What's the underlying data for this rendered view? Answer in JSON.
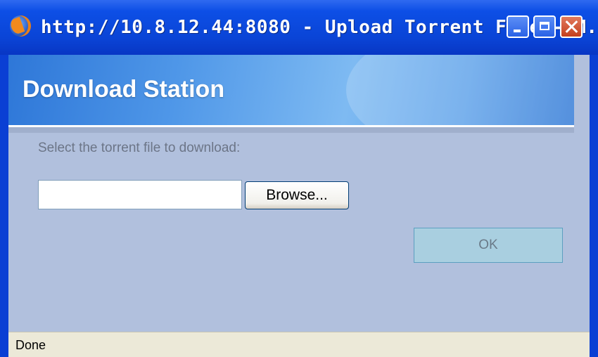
{
  "window": {
    "title": "http://10.8.12.44:8080 - Upload Torrent File - M...",
    "controls": {
      "minimize": "minimize-icon",
      "maximize": "maximize-icon",
      "close": "close-icon"
    }
  },
  "banner": {
    "title": "Download Station"
  },
  "form": {
    "prompt": "Select the torrent file to download:",
    "file_value": "",
    "browse_label": "Browse...",
    "ok_label": "OK"
  },
  "status": {
    "text": "Done"
  },
  "colors": {
    "titlebar": "#0a44d6",
    "client_bg": "#b1c0dd",
    "banner": "#4f97e8",
    "ok_button": "#a9cfe0",
    "statusbar": "#ece9d8"
  }
}
